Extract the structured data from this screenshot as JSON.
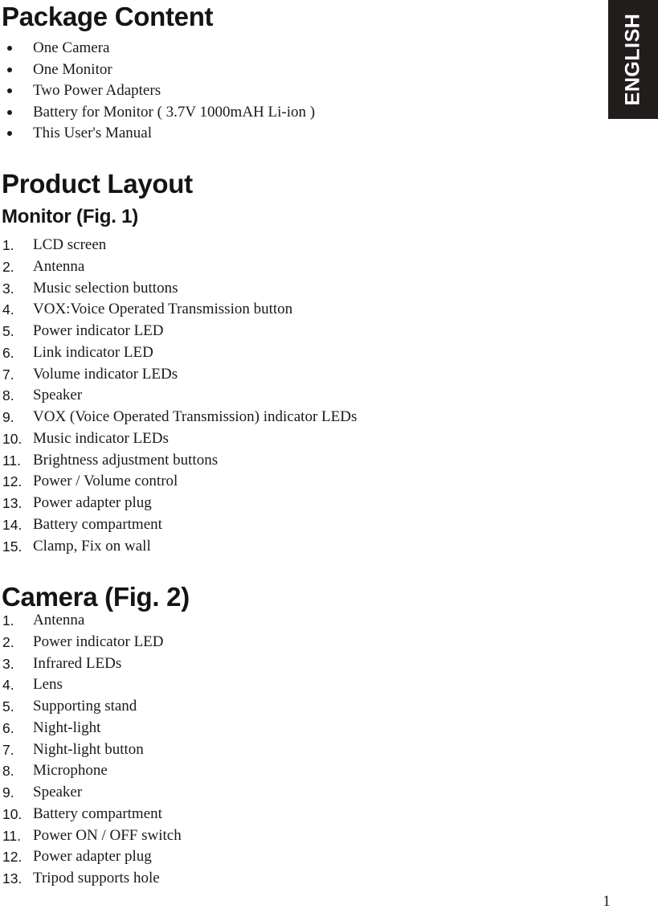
{
  "language_tab": {
    "label": "ENGLISH",
    "background": "#211d1c",
    "text_color": "#ffffff"
  },
  "package_content": {
    "title": "Package Content",
    "items": [
      "One Camera",
      "One Monitor",
      "Two Power Adapters",
      "Battery for Monitor ( 3.7V  1000mAH  Li-ion )",
      "This User's Manual"
    ]
  },
  "product_layout": {
    "title": "Product Layout",
    "monitor": {
      "subtitle": "Monitor (Fig. 1)",
      "items": [
        {
          "num": "1.",
          "text": "LCD screen"
        },
        {
          "num": "2.",
          "text": "Antenna"
        },
        {
          "num": "3.",
          "text": "Music selection buttons"
        },
        {
          "num": "4.",
          "text": "VOX:Voice Operated Transmission button"
        },
        {
          "num": "5.",
          "text": "Power indicator LED"
        },
        {
          "num": "6.",
          "text": "Link indicator LED"
        },
        {
          "num": "7.",
          "text": "Volume indicator LEDs"
        },
        {
          "num": "8.",
          "text": "Speaker"
        },
        {
          "num": "9.",
          "text": "VOX (Voice Operated Transmission) indicator LEDs"
        },
        {
          "num": "10.",
          "text": "Music indicator LEDs"
        },
        {
          "num": "11.",
          "text": "Brightness adjustment buttons"
        },
        {
          "num": "12.",
          "text": "Power / Volume control"
        },
        {
          "num": "13.",
          "text": "Power adapter plug"
        },
        {
          "num": "14.",
          "text": "Battery compartment"
        },
        {
          "num": "15.",
          "text": "Clamp, Fix on wall"
        }
      ]
    },
    "camera": {
      "subtitle": "Camera (Fig. 2)",
      "items": [
        {
          "num": "1.",
          "text": "Antenna"
        },
        {
          "num": "2.",
          "text": "Power indicator LED"
        },
        {
          "num": "3.",
          "text": "Infrared LEDs"
        },
        {
          "num": "4.",
          "text": "Lens"
        },
        {
          "num": "5.",
          "text": "Supporting stand"
        },
        {
          "num": "6.",
          "text": "Night-light"
        },
        {
          "num": "7.",
          "text": "Night-light button"
        },
        {
          "num": "8.",
          "text": "Microphone"
        },
        {
          "num": "9.",
          "text": "Speaker"
        },
        {
          "num": "10.",
          "text": "Battery compartment"
        },
        {
          "num": "11.",
          "text": "Power ON / OFF switch"
        },
        {
          "num": "12.",
          "text": "Power adapter plug"
        },
        {
          "num": "13.",
          "text": "Tripod supports hole"
        }
      ]
    }
  },
  "footer": {
    "page_number": "1"
  }
}
